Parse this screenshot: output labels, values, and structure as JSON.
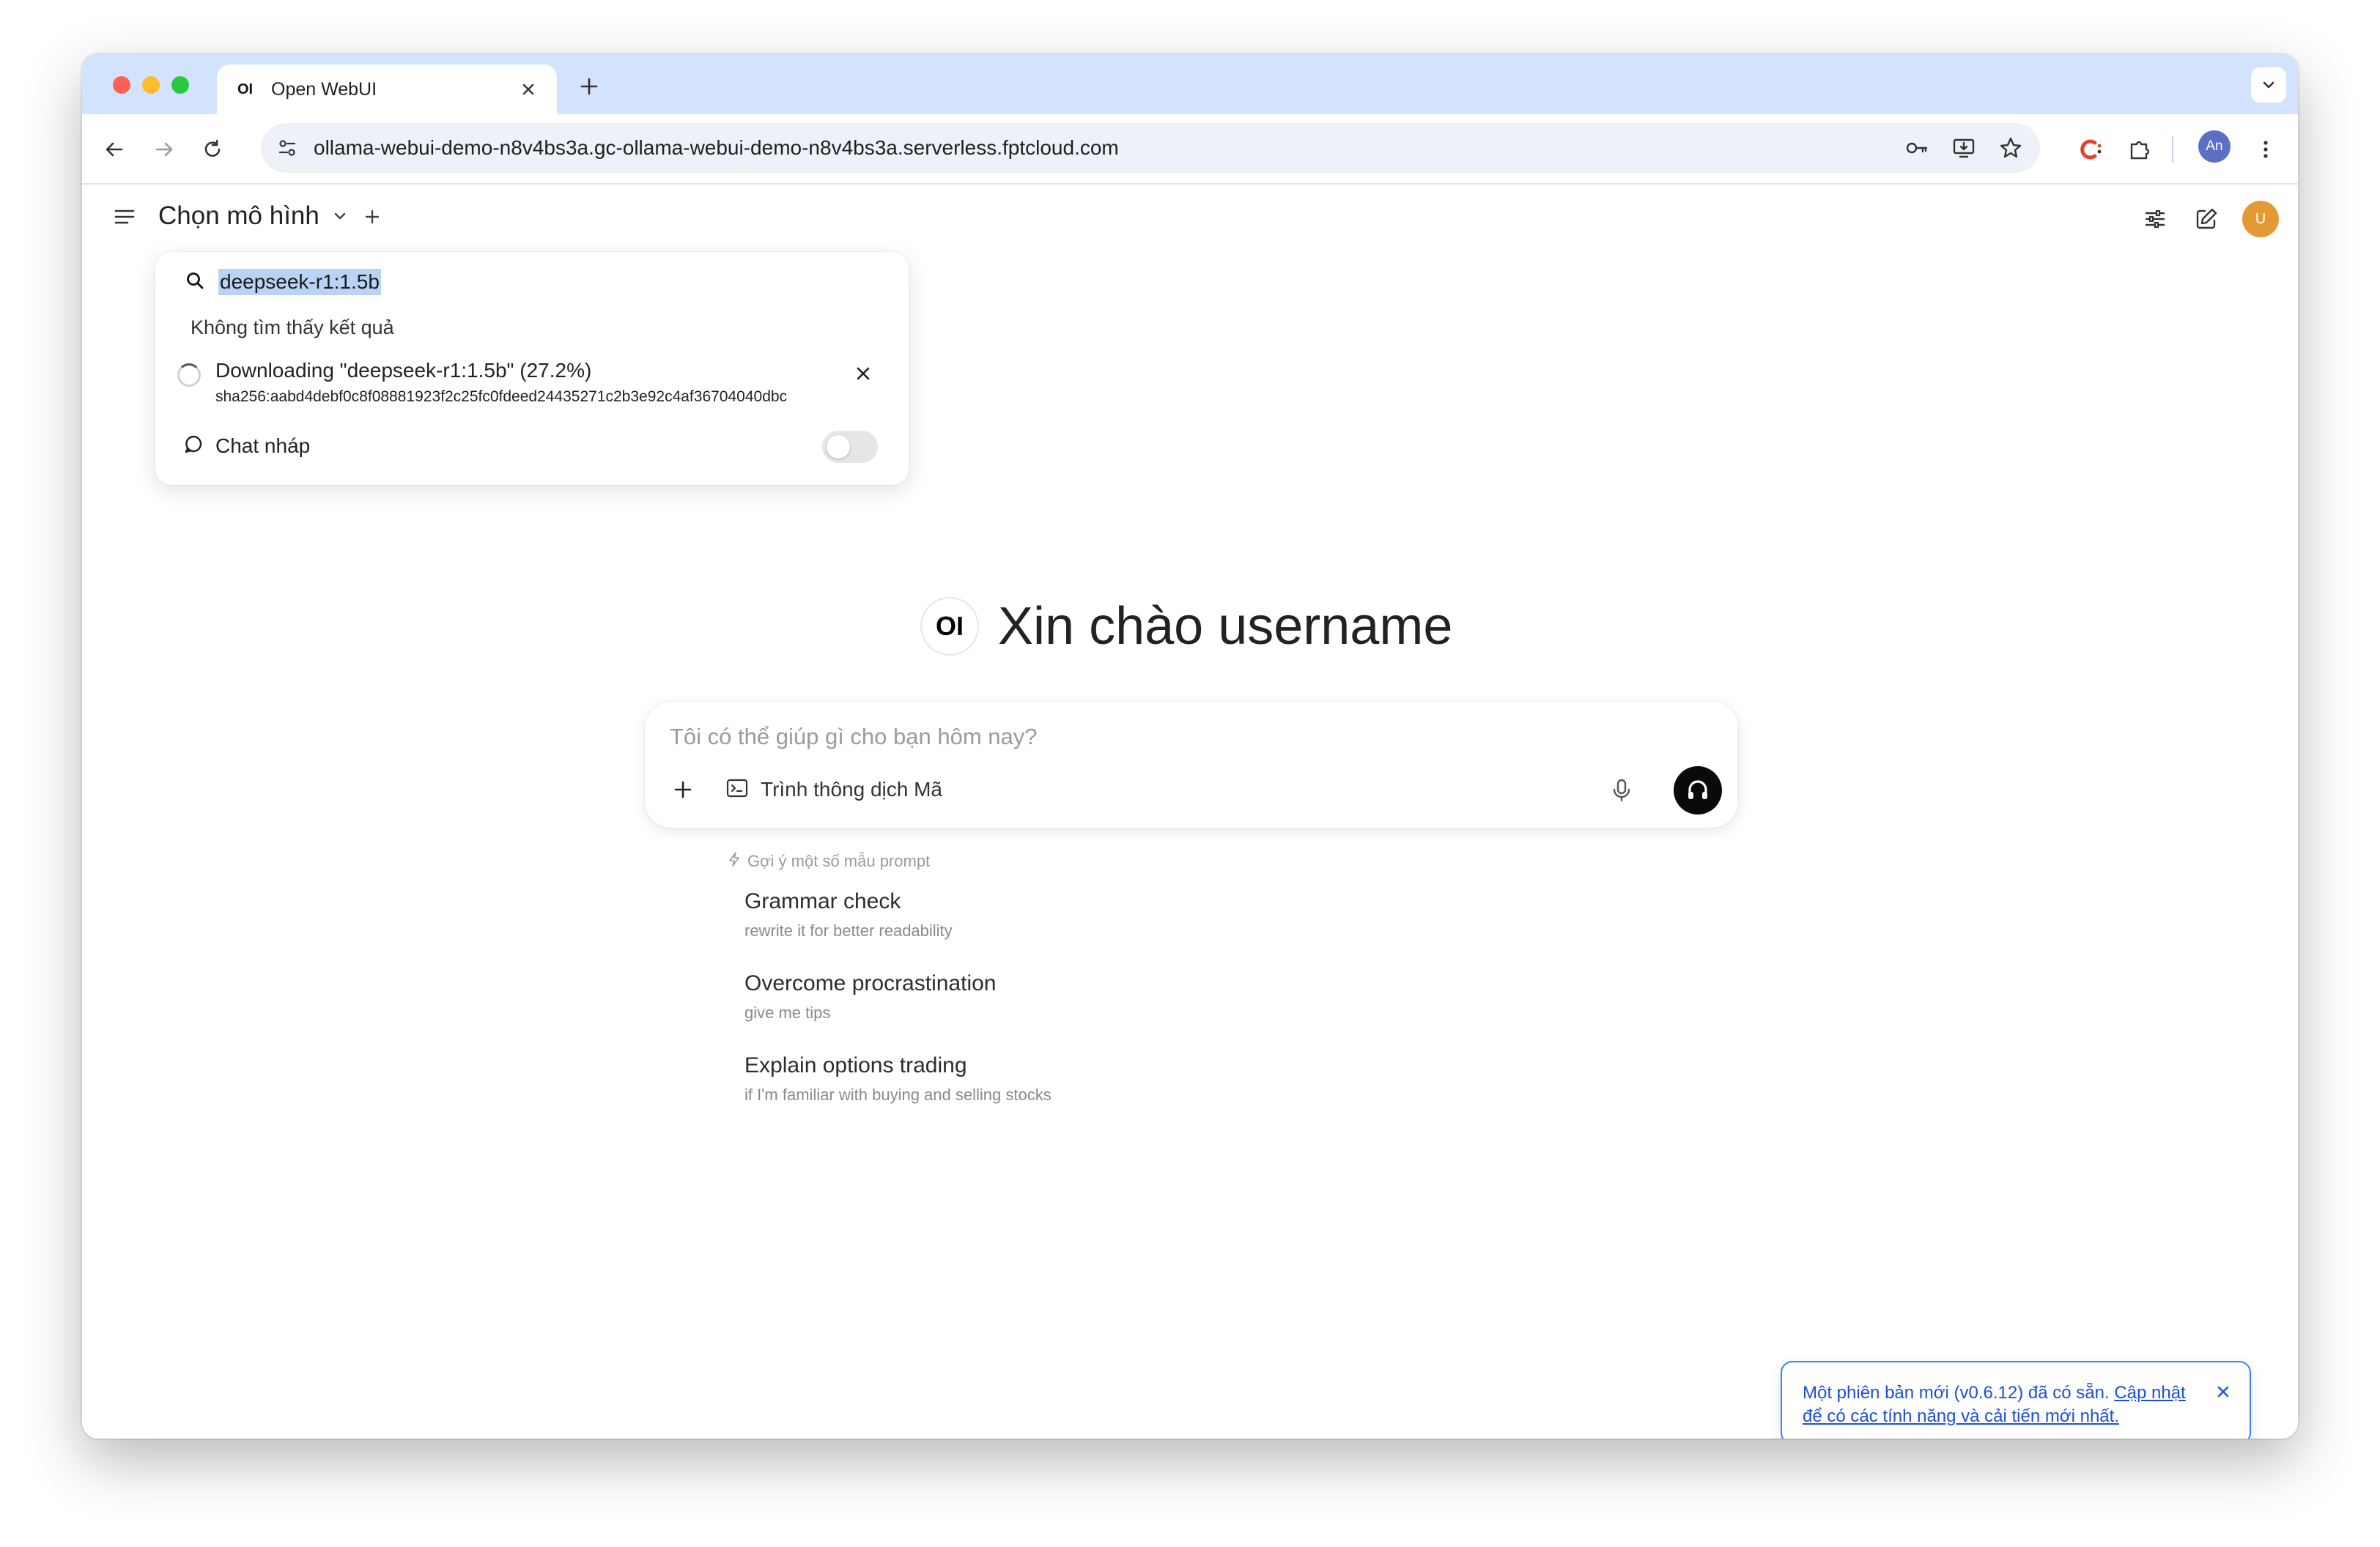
{
  "browser": {
    "tab_title": "Open WebUI",
    "tab_favicon": "OI",
    "url": "ollama-webui-demo-n8v4bs3a.gc-ollama-webui-demo-n8v4bs3a.serverless.fptcloud.com",
    "profile_initials": "An"
  },
  "header": {
    "model_select_label": "Chọn mô hình",
    "user_initial": "U"
  },
  "dropdown": {
    "search_value": "deepseek-r1:1.5b",
    "no_results": "Không tìm thấy kết quả",
    "download_title": "Downloading \"deepseek-r1:1.5b\" (27.2%)",
    "download_progress_percent": 27.2,
    "download_hash": "sha256:aabd4debf0c8f08881923f2c25fc0fdeed24435271c2b3e92c4af36704040dbc",
    "temp_chat_label": "Chat nháp",
    "temp_chat_enabled": false
  },
  "main": {
    "logo": "OI",
    "greeting": "Xin chào username",
    "input_placeholder": "Tôi có thể giúp gì cho bạn hôm nay?",
    "code_interpreter_label": "Trình thông dịch Mã",
    "suggestions_heading": "Gợi ý một số mẫu prompt",
    "suggestions": [
      {
        "title": "Grammar check",
        "subtitle": "rewrite it for better readability"
      },
      {
        "title": "Overcome procrastination",
        "subtitle": "give me tips"
      },
      {
        "title": "Explain options trading",
        "subtitle": "if I'm familiar with buying and selling stocks"
      }
    ]
  },
  "toast": {
    "text": "Một phiên bản mới (v0.6.12) đã có sẵn.",
    "link": "Cập nhật để có các tính năng và cải tiến mới nhất."
  },
  "help_label": "?",
  "colors": {
    "tabstrip": "#d3e3fd",
    "toast_accent": "#3b82f6",
    "avatar": "#e39a35"
  }
}
